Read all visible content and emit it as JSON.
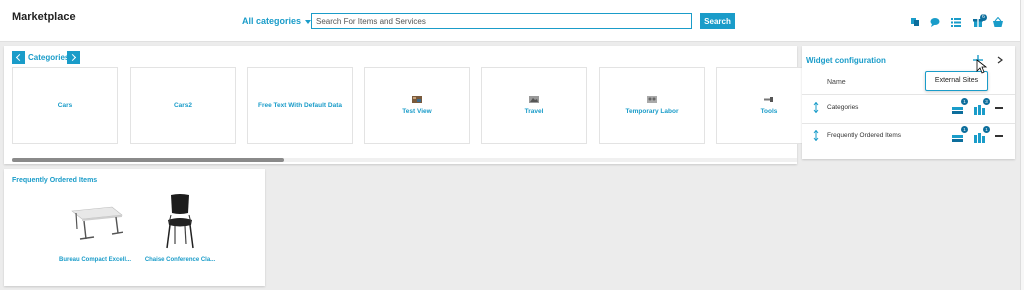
{
  "header": {
    "title": "Marketplace",
    "categories_dropdown": "All categories",
    "search_placeholder": "Search For Items and Services",
    "search_button": "Search",
    "cart_count": "6",
    "icons": [
      "orders-icon",
      "chat-icon",
      "list-icon",
      "gift-icon",
      "basket-icon"
    ]
  },
  "categories_panel": {
    "title": "Categories",
    "tiles": [
      {
        "label": "Cars",
        "icon": null
      },
      {
        "label": "Cars2",
        "icon": null
      },
      {
        "label": "Free Text With Default Data",
        "icon": null
      },
      {
        "label": "Test View",
        "icon": "thumbnail"
      },
      {
        "label": "Travel",
        "icon": "thumbnail"
      },
      {
        "label": "Temporary Labor",
        "icon": "thumbnail"
      },
      {
        "label": "Tools",
        "icon": "thumbnail"
      }
    ]
  },
  "frequent_panel": {
    "title": "Frequently Ordered Items",
    "items": [
      {
        "label": "Bureau Compact Excell...",
        "icon": "desk"
      },
      {
        "label": "Chaise Conference Cla...",
        "icon": "chair"
      }
    ]
  },
  "widget_panel": {
    "title": "Widget configuration",
    "column_name": "Name",
    "rows": [
      {
        "label": "Categories",
        "badge1": "1",
        "badge2": "3"
      },
      {
        "label": "Frequently Ordered Items",
        "badge1": "1",
        "badge2": "1"
      }
    ],
    "tooltip": "External Sites"
  },
  "colors": {
    "accent": "#1a9cc9",
    "dark_accent": "#0d6e9c",
    "background": "#ececec"
  }
}
